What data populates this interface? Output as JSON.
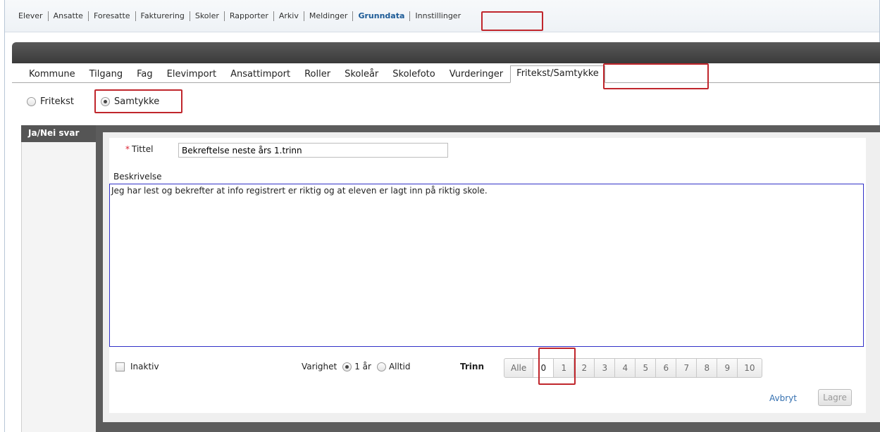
{
  "topnav": {
    "items": [
      "Elever",
      "Ansatte",
      "Foresatte",
      "Fakturering",
      "Skoler",
      "Rapporter",
      "Arkiv",
      "Meldinger",
      "Grunndata",
      "Innstillinger"
    ],
    "active": "Grunndata"
  },
  "tabs": {
    "items": [
      "Kommune",
      "Tilgang",
      "Fag",
      "Elevimport",
      "Ansattimport",
      "Roller",
      "Skoleår",
      "Skolefoto",
      "Vurderinger",
      "Fritekst/Samtykke"
    ],
    "active": "Fritekst/Samtykke"
  },
  "mode": {
    "fritekst_label": "Fritekst",
    "samtykke_label": "Samtykke",
    "selected": "Samtykke"
  },
  "side_tab": {
    "label": "Ja/Nei svar"
  },
  "form": {
    "required_mark": "*",
    "title_label": "Tittel",
    "title_value": "Bekreftelse neste års 1.trinn",
    "description_label": "Beskrivelse",
    "description_value": "Jeg har lest og bekrefter at info registrert er riktig og at eleven er lagt inn på riktig skole.",
    "inactive_label": "Inaktiv",
    "inactive_checked": false,
    "varighet_label": "Varighet",
    "varighet_options": [
      "1 år",
      "Alltid"
    ],
    "varighet_selected": "1 år",
    "trinn_label": "Trinn",
    "trinn_options": [
      "Alle",
      "0",
      "1",
      "2",
      "3",
      "4",
      "5",
      "6",
      "7",
      "8",
      "9",
      "10"
    ],
    "trinn_selected": "0",
    "cancel_label": "Avbryt",
    "save_label": "Lagre"
  },
  "colors": {
    "highlight": "#c0262c",
    "active_nav": "#1c5a96",
    "dark_panel": "#5c5c5c",
    "textarea_border": "#3131c8",
    "link": "#3570b0"
  }
}
